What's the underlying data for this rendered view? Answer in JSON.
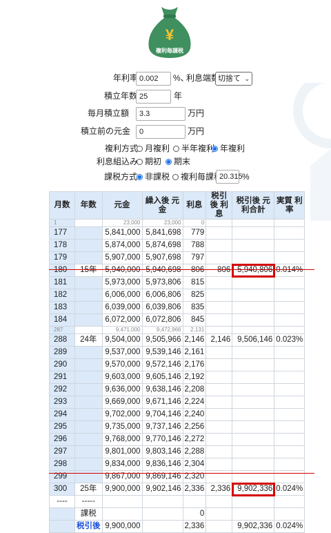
{
  "logo": {
    "symbol": "¥",
    "text": "複利毎課税"
  },
  "form": {
    "rate_label": "年利率",
    "rate_value": "0.002",
    "rate_unit": "%、",
    "rounding_label": "利息端数",
    "rounding_value": "切捨て",
    "years_label": "積立年数",
    "years_value": "25",
    "years_unit": "年",
    "monthly_label": "毎月積立額",
    "monthly_value": "3.3",
    "monthly_unit": "万円",
    "initial_label": "積立前の元金",
    "initial_value": "0",
    "initial_unit": "万円",
    "compound_label": "複利方式",
    "compound_opts": [
      "月複利",
      "半年複利",
      "年複利"
    ],
    "interest_label": "利息組込み",
    "interest_opts": [
      "期初",
      "期末"
    ],
    "tax_label": "課税方式",
    "tax_opts": [
      "非課税",
      "複利毎課税"
    ],
    "tax_rate": "20.315",
    "tax_unit": "%"
  },
  "table": {
    "headers": [
      "月数",
      "年数",
      "元金",
      "繰入後 元金",
      "利息",
      "税引後 利息",
      "税引後 元利合計",
      "実質 利率"
    ],
    "top_partial": [
      "1",
      "",
      "23,000",
      "23,000",
      "0"
    ],
    "block1": [
      [
        "177",
        "",
        "5,841,000",
        "5,841,698",
        "779",
        "",
        "",
        ""
      ],
      [
        "178",
        "",
        "5,874,000",
        "5,874,698",
        "788",
        "",
        "",
        ""
      ],
      [
        "179",
        "",
        "5,907,000",
        "5,907,698",
        "797",
        "",
        "",
        ""
      ],
      [
        "180",
        "15年",
        "5,940,000",
        "5,940,698",
        "806",
        "806",
        "5,940,806",
        "0.014%"
      ],
      [
        "181",
        "",
        "5,973,000",
        "5,973,806",
        "815",
        "",
        "",
        ""
      ],
      [
        "182",
        "",
        "6,006,000",
        "6,006,806",
        "825",
        "",
        "",
        ""
      ],
      [
        "183",
        "",
        "6,039,000",
        "6,039,806",
        "835",
        "",
        "",
        ""
      ],
      [
        "184",
        "",
        "6,072,000",
        "6,072,806",
        "845",
        "",
        "",
        ""
      ]
    ],
    "mid_partial": [
      "287",
      "",
      "9,471,000",
      "9,472,966",
      "2,131"
    ],
    "block2": [
      [
        "288",
        "24年",
        "9,504,000",
        "9,505,966",
        "2,146",
        "2,146",
        "9,506,146",
        "0.023%"
      ],
      [
        "289",
        "",
        "9,537,000",
        "9,539,146",
        "2,161",
        "",
        "",
        ""
      ],
      [
        "290",
        "",
        "9,570,000",
        "9,572,146",
        "2,176",
        "",
        "",
        ""
      ],
      [
        "291",
        "",
        "9,603,000",
        "9,605,146",
        "2,192",
        "",
        "",
        ""
      ],
      [
        "292",
        "",
        "9,636,000",
        "9,638,146",
        "2,208",
        "",
        "",
        ""
      ],
      [
        "293",
        "",
        "9,669,000",
        "9,671,146",
        "2,224",
        "",
        "",
        ""
      ],
      [
        "294",
        "",
        "9,702,000",
        "9,704,146",
        "2,240",
        "",
        "",
        ""
      ],
      [
        "295",
        "",
        "9,735,000",
        "9,737,146",
        "2,256",
        "",
        "",
        ""
      ],
      [
        "296",
        "",
        "9,768,000",
        "9,770,146",
        "2,272",
        "",
        "",
        ""
      ],
      [
        "297",
        "",
        "9,801,000",
        "9,803,146",
        "2,288",
        "",
        "",
        ""
      ],
      [
        "298",
        "",
        "9,834,000",
        "9,836,146",
        "2,304",
        "",
        "",
        ""
      ],
      [
        "299",
        "",
        "9,867,000",
        "9,869,146",
        "2,320",
        "",
        "",
        ""
      ],
      [
        "300",
        "25年",
        "9,900,000",
        "9,902,146",
        "2,336",
        "2,336",
        "9,902,336",
        "0.024%"
      ]
    ],
    "sep": [
      "----",
      "-----"
    ],
    "tax_row": {
      "label": "課税",
      "interest": "0"
    },
    "after_tax_row": {
      "label": "税引後",
      "principal": "9,900,000",
      "interest": "2,336",
      "total": "9,902,336",
      "rate": "0.024%"
    }
  },
  "colors": {
    "logo_green": "#3f8f5f",
    "header_bg": "#dbe9f8",
    "highlight": "#d40000"
  }
}
